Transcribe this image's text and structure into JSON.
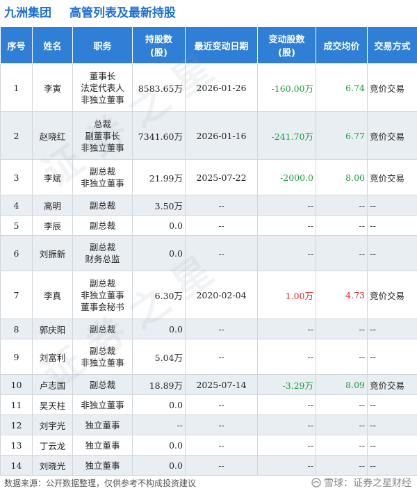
{
  "header": {
    "company": "九洲集团",
    "title": "高管列表及最新持股"
  },
  "table": {
    "columns": [
      "序号",
      "姓名",
      "职务",
      "持股数\n(股)",
      "最近变动日期",
      "变动股数\n(股)",
      "成交均价",
      "交易方式"
    ],
    "rows": [
      {
        "no": "1",
        "name": "李寅",
        "roles": [
          "董事长",
          "法定代表人",
          "非独立董事"
        ],
        "shares": "8583.65万",
        "date": "2026-01-26",
        "change": "-160.00万",
        "price": "6.74",
        "method": "竞价交易"
      },
      {
        "no": "2",
        "name": "赵晓红",
        "roles": [
          "总裁",
          "副董事长",
          "非独立董事"
        ],
        "shares": "7341.60万",
        "date": "2026-01-16",
        "change": "-241.70万",
        "price": "6.77",
        "method": "竞价交易"
      },
      {
        "no": "3",
        "name": "李斌",
        "roles": [
          "副总裁",
          "非独立董事"
        ],
        "shares": "21.99万",
        "date": "2025-07-22",
        "change": "-2000.0",
        "price": "8.00",
        "method": "竞价交易"
      },
      {
        "no": "4",
        "name": "高明",
        "roles": [
          "副总裁"
        ],
        "shares": "3.50万",
        "date": "--",
        "change": "--",
        "price": "--",
        "method": "--"
      },
      {
        "no": "5",
        "name": "李辰",
        "roles": [
          "副总裁"
        ],
        "shares": "0.0",
        "date": "--",
        "change": "--",
        "price": "--",
        "method": "--"
      },
      {
        "no": "6",
        "name": "刘振新",
        "roles": [
          "副总裁",
          "财务总监"
        ],
        "shares": "0.0",
        "date": "--",
        "change": "--",
        "price": "--",
        "method": "--"
      },
      {
        "no": "7",
        "name": "李真",
        "roles": [
          "副总裁",
          "非独立董事",
          "董事会秘书"
        ],
        "shares": "6.30万",
        "date": "2020-02-04",
        "change": "1.00万",
        "price": "4.73",
        "method": "竞价交易"
      },
      {
        "no": "8",
        "name": "郭庆阳",
        "roles": [
          "副总裁"
        ],
        "shares": "0.0",
        "date": "--",
        "change": "--",
        "price": "--",
        "method": "--"
      },
      {
        "no": "9",
        "name": "刘富利",
        "roles": [
          "副总裁",
          "非独立董事"
        ],
        "shares": "5.04万",
        "date": "--",
        "change": "--",
        "price": "--",
        "method": "--"
      },
      {
        "no": "10",
        "name": "卢志国",
        "roles": [
          "副总裁"
        ],
        "shares": "18.89万",
        "date": "2025-07-14",
        "change": "-3.29万",
        "price": "8.09",
        "method": "竞价交易"
      },
      {
        "no": "11",
        "name": "吴天柱",
        "roles": [
          "非独立董事"
        ],
        "shares": "0.0",
        "date": "--",
        "change": "--",
        "price": "--",
        "method": "--"
      },
      {
        "no": "12",
        "name": "刘宇光",
        "roles": [
          "独立董事"
        ],
        "shares": "--",
        "date": "--",
        "change": "--",
        "price": "--",
        "method": "--"
      },
      {
        "no": "13",
        "name": "丁云龙",
        "roles": [
          "独立董事"
        ],
        "shares": "0.0",
        "date": "--",
        "change": "--",
        "price": "--",
        "method": "--"
      },
      {
        "no": "14",
        "name": "刘晓光",
        "roles": [
          "独立董事"
        ],
        "shares": "0.0",
        "date": "--",
        "change": "--",
        "price": "--",
        "method": "--"
      }
    ]
  },
  "footer": {
    "source": "数据来源：公开数据整理，仅供参考不构成投资建议",
    "brand": "雪球：证券之星财经"
  },
  "colors": {
    "header_bg": "#2f7fd6",
    "title": "#1e6fd0",
    "decrease": "#1b9e3e",
    "increase": "#e0242b"
  }
}
